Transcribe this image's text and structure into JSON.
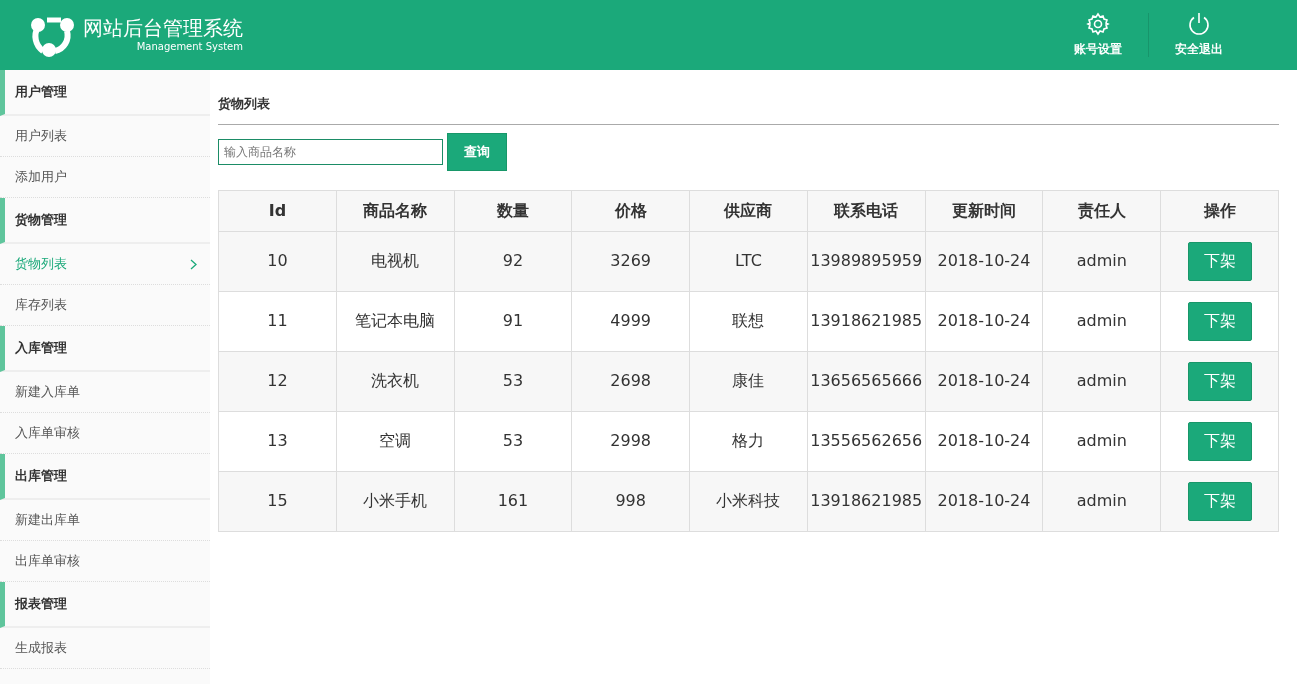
{
  "header": {
    "title": "网站后台管理系统",
    "subtitle": "Management System",
    "actions": [
      {
        "kind": "settings",
        "label": "账号设置"
      },
      {
        "kind": "logout",
        "label": "安全退出"
      }
    ]
  },
  "sidebar": {
    "groups": [
      {
        "title": "用户管理",
        "items": [
          {
            "label": "用户列表",
            "selected": false
          },
          {
            "label": "添加用户",
            "selected": false
          }
        ]
      },
      {
        "title": "货物管理",
        "items": [
          {
            "label": "货物列表",
            "selected": true
          },
          {
            "label": "库存列表",
            "selected": false
          }
        ]
      },
      {
        "title": "入库管理",
        "items": [
          {
            "label": "新建入库单",
            "selected": false
          },
          {
            "label": "入库单审核",
            "selected": false
          }
        ]
      },
      {
        "title": "出库管理",
        "items": [
          {
            "label": "新建出库单",
            "selected": false
          },
          {
            "label": "出库单审核",
            "selected": false
          }
        ]
      },
      {
        "title": "报表管理",
        "items": [
          {
            "label": "生成报表",
            "selected": false
          }
        ]
      }
    ]
  },
  "content": {
    "title": "货物列表",
    "search": {
      "placeholder": "输入商品名称",
      "button": "查询"
    },
    "table": {
      "columns": [
        "Id",
        "商品名称",
        "数量",
        "价格",
        "供应商",
        "联系电话",
        "更新时间",
        "责任人",
        "操作"
      ],
      "rows": [
        {
          "cells": [
            "10",
            "电视机",
            "92",
            "3269",
            "LTC",
            "13989895959",
            "2018-10-24",
            "admin"
          ],
          "action": "下架"
        },
        {
          "cells": [
            "11",
            "笔记本电脑",
            "91",
            "4999",
            "联想",
            "13918621985",
            "2018-10-24",
            "admin"
          ],
          "action": "下架"
        },
        {
          "cells": [
            "12",
            "洗衣机",
            "53",
            "2698",
            "康佳",
            "13656565666",
            "2018-10-24",
            "admin"
          ],
          "action": "下架"
        },
        {
          "cells": [
            "13",
            "空调",
            "53",
            "2998",
            "格力",
            "13556562656",
            "2018-10-24",
            "admin"
          ],
          "action": "下架"
        },
        {
          "cells": [
            "15",
            "小米手机",
            "161",
            "998",
            "小米科技",
            "13918621985",
            "2018-10-24",
            "admin"
          ],
          "action": "下架"
        }
      ]
    }
  }
}
